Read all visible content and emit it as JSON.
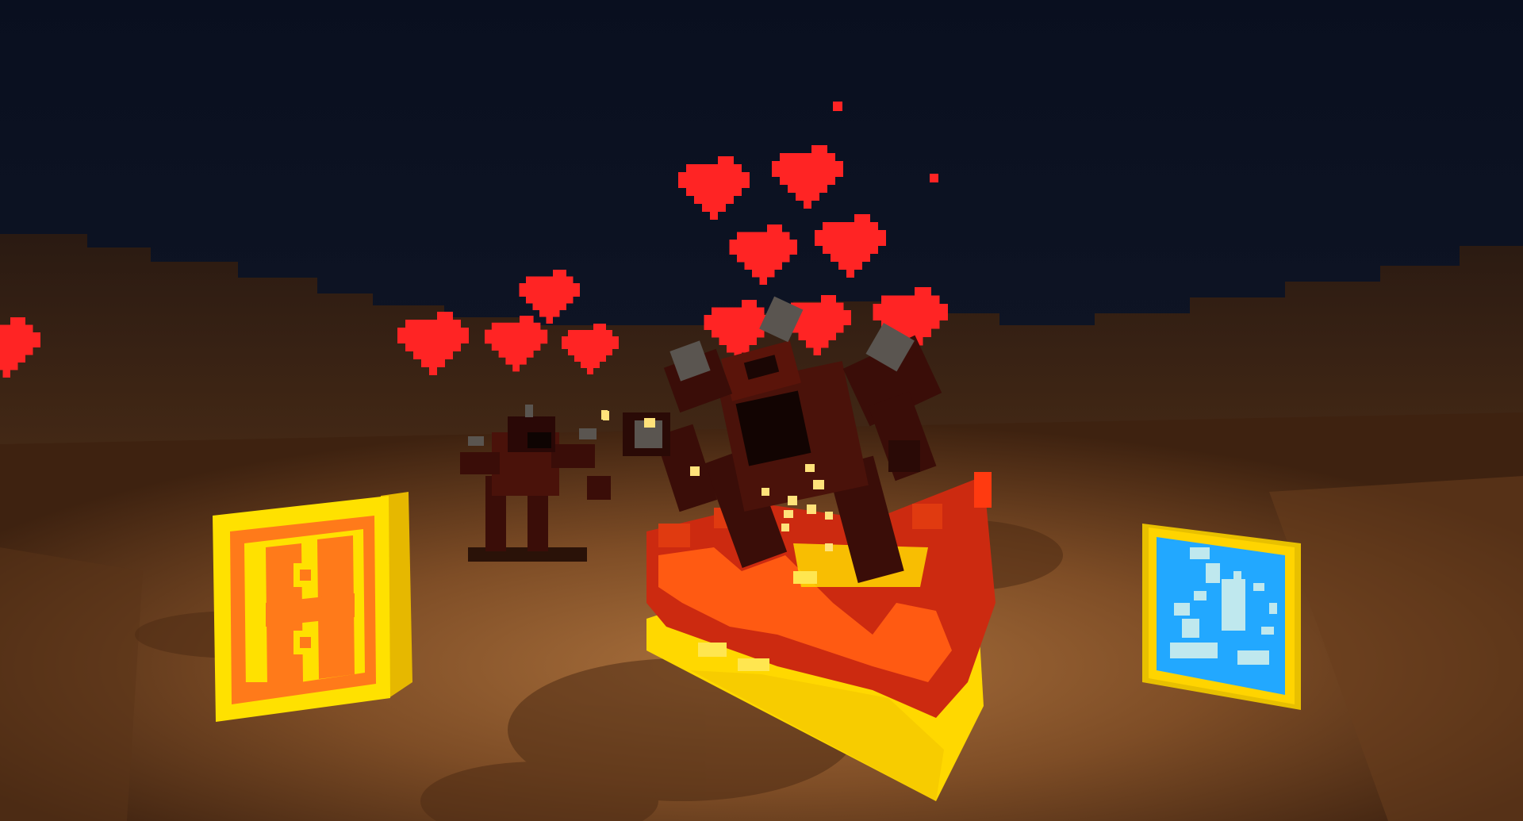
{
  "scene": {
    "description_text": "",
    "colors": {
      "sky_top": "#0a1020",
      "sky_bottom": "#1b1a22",
      "ground": "#8a5a32",
      "ground_dark": "#5a3418",
      "heart": "#ff2424",
      "lava_red": "#cc2a10",
      "lava_orange": "#ff5a12",
      "lava_yellow": "#ffd800",
      "crate_yellow": "#ffe100",
      "crate_orange": "#ff7a1a",
      "crate_blue": "#22a8ff",
      "crate_ice": "#bfe8ee",
      "monster_body": "#3a0d08",
      "monster_dark": "#1a0604",
      "monster_horn": "#5a5550"
    },
    "icons": [
      "heart-icon",
      "h-crate-icon",
      "ice-crystal-icon",
      "lava-pool-icon",
      "demon-monster-icon"
    ]
  }
}
